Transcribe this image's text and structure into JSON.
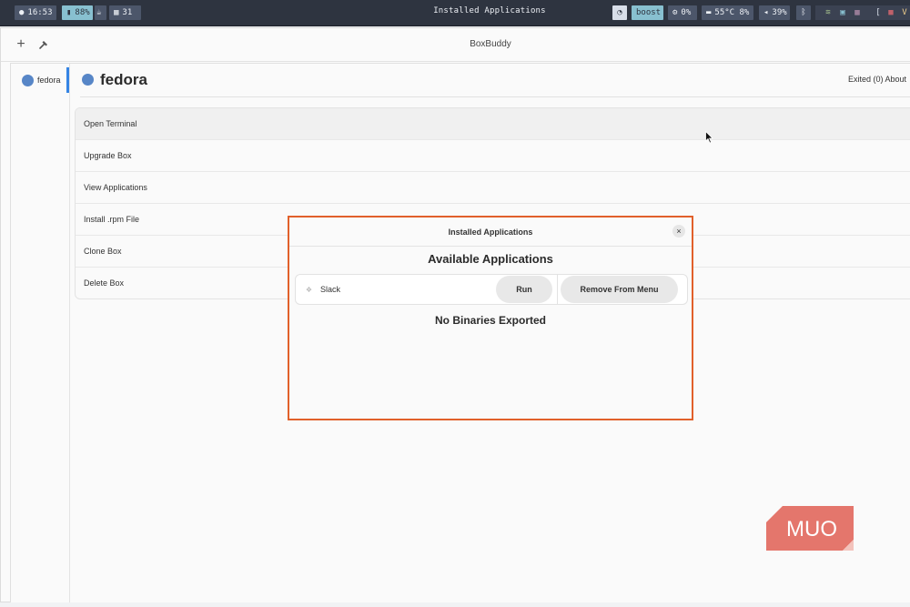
{
  "system_bar": {
    "clock": "16:53",
    "battery": "88%",
    "workspace": "31",
    "window_title": "Installed Applications",
    "boost": "boost",
    "cpu": "0%",
    "temp": "55°C 8%",
    "volume": "39%"
  },
  "window": {
    "title": "BoxBuddy",
    "add_icon": "+"
  },
  "sidebar": {
    "items": [
      {
        "label": "fedora"
      }
    ]
  },
  "main": {
    "title": "fedora",
    "status": "Exited (0) About",
    "actions": [
      {
        "label": "Open Terminal"
      },
      {
        "label": "Upgrade Box"
      },
      {
        "label": "View Applications"
      },
      {
        "label": "Install .rpm File"
      },
      {
        "label": "Clone Box"
      },
      {
        "label": "Delete Box"
      }
    ]
  },
  "dialog": {
    "title": "Installed Applications",
    "section_title": "Available Applications",
    "app": {
      "name": "Slack",
      "run_label": "Run",
      "remove_label": "Remove From Menu"
    },
    "empty_message": "No Binaries Exported",
    "close_glyph": "×"
  },
  "watermark": {
    "text": "MUO"
  },
  "colors": {
    "accent": "#3584e4",
    "highlight": "#e1602b",
    "distro_dot": "#5786c7",
    "watermark": "#e4766c"
  }
}
